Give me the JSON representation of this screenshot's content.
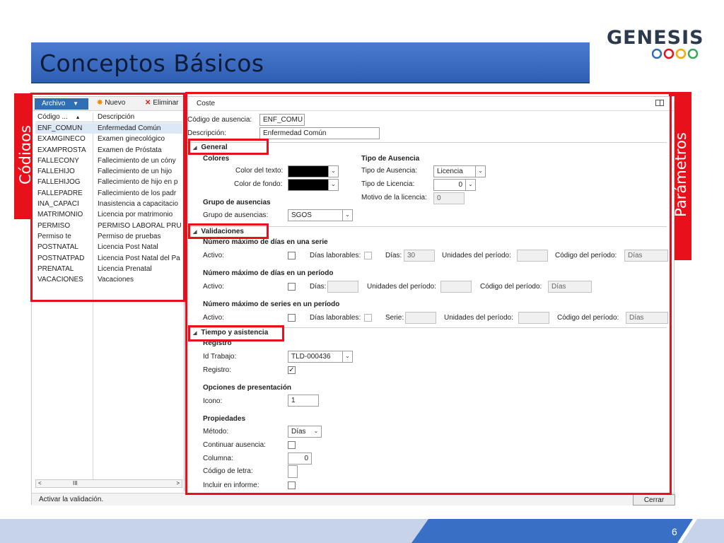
{
  "slide": {
    "title": "Conceptos Básicos",
    "logo": "GENESIS",
    "page_number": "6",
    "left_label": "Códigos",
    "right_label": "Parámetros"
  },
  "toolbar": {
    "archivo": "Archivo",
    "nuevo": "Nuevo",
    "eliminar": "Eliminar"
  },
  "list": {
    "col_code": "Código ...",
    "col_desc": "Descripción",
    "rows": [
      {
        "code": "ENF_COMUN",
        "desc": "Enfermedad Común"
      },
      {
        "code": "EXAMGINECO",
        "desc": "Examen ginecológico"
      },
      {
        "code": "EXAMPROSTA",
        "desc": "Examen de Próstata"
      },
      {
        "code": "FALLECONY",
        "desc": "Fallecimiento de un cóny"
      },
      {
        "code": "FALLEHIJO",
        "desc": "Fallecimiento de un hijo"
      },
      {
        "code": "FALLEHIJOG",
        "desc": "Fallecimiento de hijo en p"
      },
      {
        "code": "FALLEPADRE",
        "desc": "Fallecimiento de los padr"
      },
      {
        "code": "INA_CAPACI",
        "desc": "Inasistencia a capacitacio"
      },
      {
        "code": "MATRIMONIO",
        "desc": "Licencia por matrimonio"
      },
      {
        "code": "PERMISO",
        "desc": "PERMISO LABORAL PRUE"
      },
      {
        "code": "Permiso te",
        "desc": "Permiso de pruebas"
      },
      {
        "code": "POSTNATAL",
        "desc": "Licencia Post Natal"
      },
      {
        "code": "POSTNATPAD",
        "desc": "Licencia Post Natal del Pa"
      },
      {
        "code": "PRENATAL",
        "desc": "Licencia Prenatal"
      },
      {
        "code": "VACACIONES",
        "desc": "Vacaciones"
      }
    ]
  },
  "status": {
    "text": "Activar la validación.",
    "close": "Cerrar"
  },
  "details": {
    "tab": "Coste",
    "codigo_label": "Código de ausencia:",
    "codigo_value": "ENF_COMU",
    "descripcion_label": "Descripción:",
    "descripcion_value": "Enfermedad Común",
    "general": {
      "title": "General",
      "colores": "Colores",
      "color_texto": "Color del texto:",
      "color_fondo": "Color de fondo:",
      "tipo_ausencia_group": "Tipo de Ausencia",
      "tipo_ausencia_label": "Tipo de Ausencia:",
      "tipo_ausencia_value": "Licencia",
      "tipo_licencia_label": "Tipo de Licencia:",
      "tipo_licencia_value": "0",
      "motivo_label": "Motivo de la licencia:",
      "motivo_value": "0",
      "grupo_group": "Grupo de ausencias",
      "grupo_label": "Grupo de ausencias:",
      "grupo_value": "SGOS"
    },
    "validaciones": {
      "title": "Validaciones",
      "serie_title": "Número máximo de días en una serie",
      "periodo_title": "Número máximo de días en un período",
      "series_title": "Número máximo de series en un período",
      "activo": "Activo:",
      "dias_laborables": "Días laborables:",
      "dias": "Días:",
      "dias_value": "30",
      "unidades": "Unidades del período:",
      "codigo_periodo": "Código del período:",
      "codigo_periodo_value": "Días",
      "serie": "Serie:"
    },
    "tiempo": {
      "title": "Tiempo y asistencia",
      "registro_group": "Registro",
      "id_trabajo_label": "Id Trabajo:",
      "id_trabajo_value": "TLD-000436",
      "registro_label": "Registro:",
      "opciones_group": "Opciones de presentación",
      "icono_label": "Icono:",
      "icono_value": "1",
      "propiedades_group": "Propiedades",
      "metodo_label": "Método:",
      "metodo_value": "Días",
      "continuar_label": "Continuar ausencia:",
      "columna_label": "Columna:",
      "columna_value": "0",
      "codigo_letra_label": "Código de letra:",
      "incluir_label": "Incluir en informe:"
    }
  },
  "colors": {
    "accent_red": "#e8101a",
    "title_blue": "#2f5fb3",
    "footer_blue": "#4a7bd0"
  }
}
